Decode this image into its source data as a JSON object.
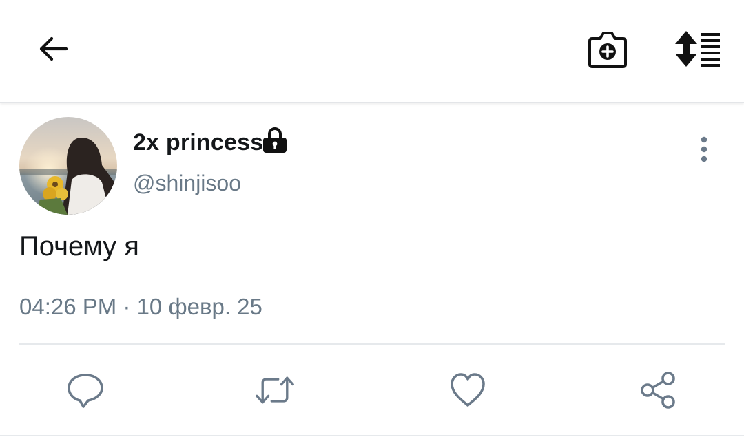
{
  "colors": {
    "text_primary": "#14171a",
    "text_secondary": "#697987",
    "action_icon": "#6b7a8a",
    "divider": "#e6e9ec"
  },
  "header": {
    "back_icon": "arrow-left-icon",
    "camera_icon": "camera-plus-icon",
    "sort_icon": "sort-list-icon"
  },
  "tweet": {
    "author": {
      "display_name": "2x princess",
      "handle": "@shinjisoo",
      "protected": true
    },
    "text": "Почему я",
    "timestamp": "04:26 PM · 10 февр. 25"
  },
  "actions": {
    "reply_icon": "speech-bubble-icon",
    "retweet_icon": "retweet-icon",
    "like_icon": "heart-icon",
    "share_icon": "share-icon"
  }
}
